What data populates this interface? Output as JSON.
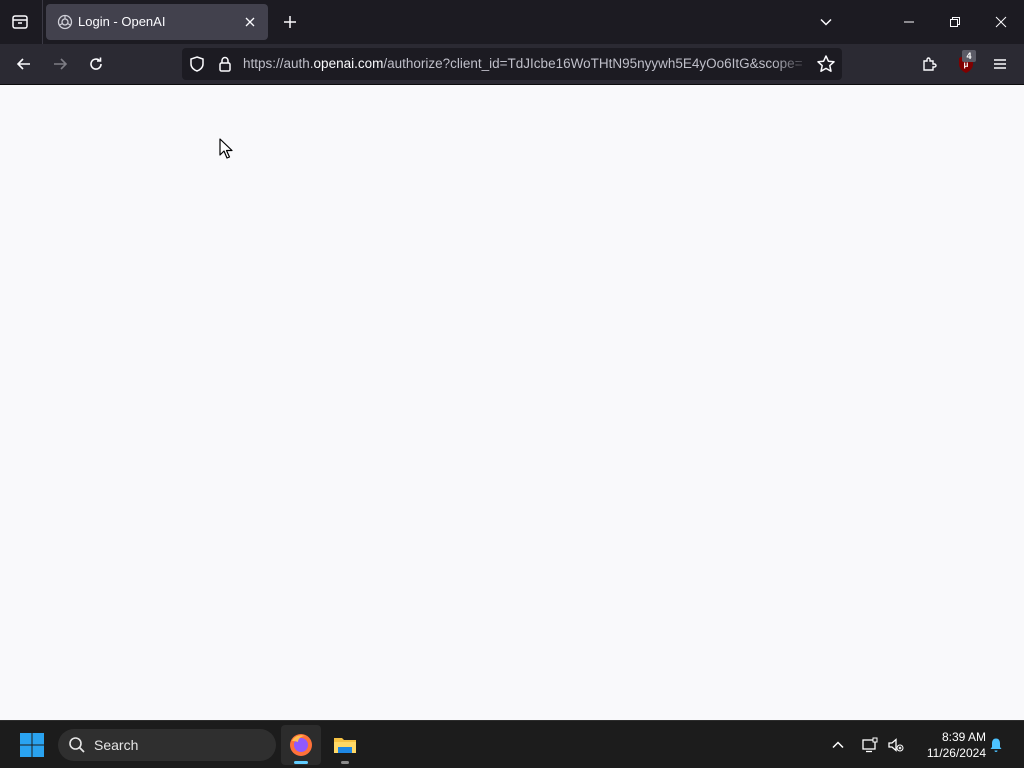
{
  "browser": {
    "tab": {
      "title": "Login - OpenAI"
    },
    "url": {
      "prefix": "https://auth.",
      "domain": "openai.com",
      "rest": "/authorize?client_id=TdJIcbe16WoTHtN95nyywh5E4yOo6ItG&scope="
    },
    "extensions": {
      "ublock_badge": "4"
    }
  },
  "taskbar": {
    "search_label": "Search",
    "clock": {
      "time": "8:39 AM",
      "date": "11/26/2024"
    }
  },
  "colors": {
    "tab_bg": "#42414d",
    "toolbar_bg": "#2b2a33",
    "page_bg": "#f9f9fb",
    "accent": "#60cdff",
    "ublock_red": "#800000"
  },
  "icons": {
    "tab_list": "tab-list-icon",
    "favicon": "openai-logo-icon",
    "back": "arrow-left-icon",
    "forward": "arrow-right-icon",
    "reload": "reload-icon",
    "shield": "shield-icon",
    "lock": "lock-icon",
    "bookmark": "star-icon",
    "extensions": "puzzle-icon",
    "menu": "hamburger-icon"
  }
}
